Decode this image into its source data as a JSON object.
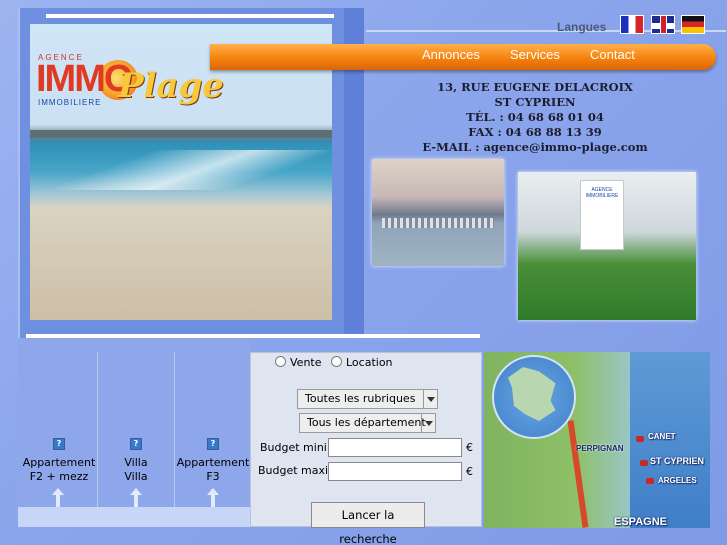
{
  "header": {
    "languages_label": "Langues",
    "flags": [
      "france-flag-icon",
      "uk-flag-icon",
      "germany-flag-icon"
    ]
  },
  "logo": {
    "agence": "AGENCE",
    "immo": "IMMO",
    "immobiliere": "IMMOBILIERE",
    "plage": "Plage"
  },
  "nav": {
    "items": [
      {
        "label": "Annonces"
      },
      {
        "label": "Services"
      },
      {
        "label": "Contact"
      }
    ]
  },
  "address": {
    "street": "13, RUE EUGENE DELACROIX",
    "city": "ST CYPRIEN",
    "tel": "TÉL. : 04 68 68 01 04",
    "fax": "FAX  : 04 68 88 13 39",
    "email": "E-MAIL : agence@immo-plage.com"
  },
  "photos": {
    "agency_sign": "AGENCE IMMOBILIERE"
  },
  "properties": [
    {
      "line1": "Appartement",
      "line2": "F2 + mezz",
      "icon": "broken-image-icon"
    },
    {
      "line1": "Villa",
      "line2": "Villa",
      "icon": "broken-image-icon"
    },
    {
      "line1": "Appartement",
      "line2": "F3",
      "icon": "broken-image-icon"
    }
  ],
  "search": {
    "radio_vente": "Vente",
    "radio_location": "Location",
    "rubriques": "Toutes les rubriques",
    "departements": "Tous les département",
    "budget_min_label": "Budget mini :",
    "budget_max_label": "Budget maxi :",
    "budget_min_value": "",
    "budget_max_value": "",
    "currency": "€",
    "submit": "Lancer la recherche"
  },
  "map": {
    "labels": {
      "perpignan": "PERPIGNAN",
      "canet": "CANET",
      "stcyprien": "ST CYPRIEN",
      "argeles": "ARGELES",
      "espagne": "ESPAGNE"
    }
  },
  "colors": {
    "background": "#7f9ee8",
    "nav_orange": "#f47e0a",
    "panel": "#dee5f0"
  }
}
